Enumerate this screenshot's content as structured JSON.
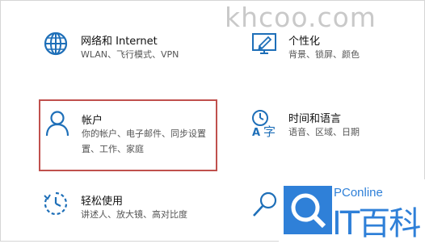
{
  "watermark": "khcoo.com",
  "tiles": [
    {
      "title": "网络和 Internet",
      "desc": [
        "WLAN、飞行模式、VPN"
      ],
      "icon": "globe-icon"
    },
    {
      "title": "个性化",
      "desc": [
        "背景、锁屏、颜色"
      ],
      "icon": "personalization-icon"
    },
    {
      "title": "帐户",
      "desc": [
        "你的帐户、电子邮件、同步设置",
        "置、工作、家庭"
      ],
      "icon": "person-icon"
    },
    {
      "title": "时间和语言",
      "desc": [
        "语音、区域、日期"
      ],
      "icon": "time-language-icon"
    },
    {
      "title": "轻松使用",
      "desc": [
        "讲述人、放大镜、高对比度"
      ],
      "icon": "ease-of-access-icon"
    },
    {
      "title": "",
      "desc": [],
      "icon": "search-icon"
    }
  ],
  "logo": {
    "top": "PConline",
    "main": "IT百科"
  },
  "colors": {
    "accent": "#1e6fb8",
    "selected_border": "#c0504d",
    "logo_blue": "#2f80d8"
  }
}
